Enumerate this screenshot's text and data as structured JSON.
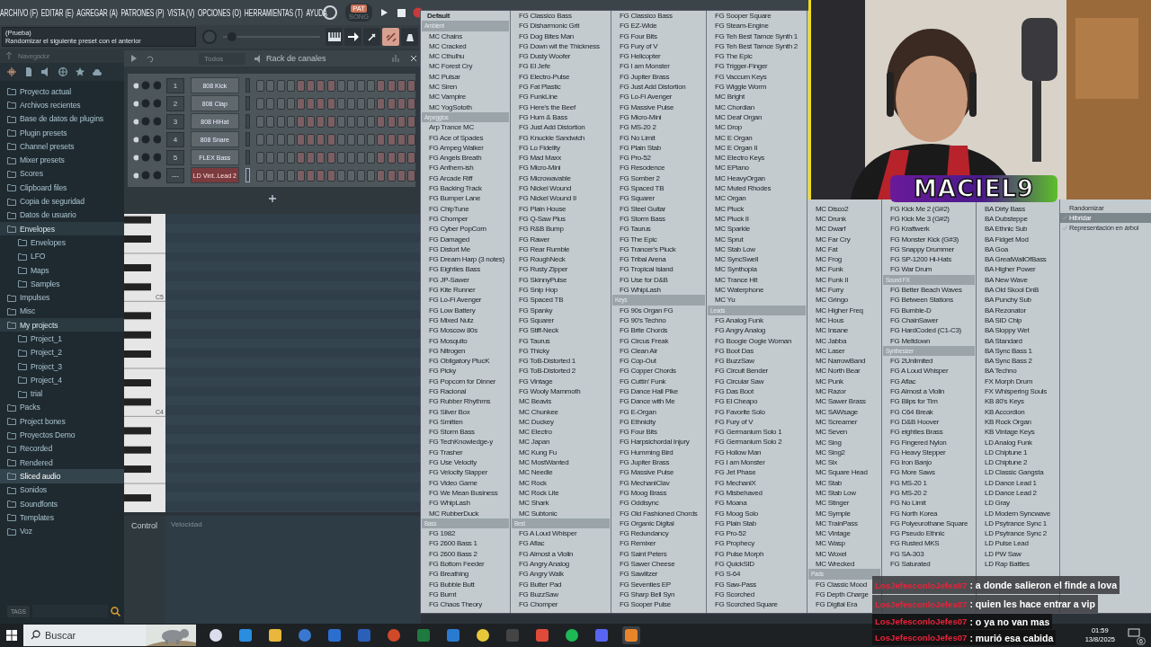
{
  "menu": [
    "ARCHIVO (F)",
    "EDITAR (E)",
    "AGREGAR (A)",
    "PATRONES (P)",
    "VISTA (V)",
    "OPCIONES (O)",
    "HERRAMIENTAS (T)",
    "AYUDA"
  ],
  "transport": {
    "modes": [
      {
        "label": "PAT",
        "selected": true
      },
      {
        "label": "SONG",
        "selected": false
      }
    ]
  },
  "pitch_slider": {
    "level": 0.05
  },
  "hint": {
    "title": "(Prueba)",
    "text": "Randomizar el siguiente preset con el anterior"
  },
  "browser": {
    "title": "Navegador",
    "tags_label": "TAGS",
    "tree": [
      {
        "label": "Proyecto actual",
        "selected": false
      },
      {
        "label": "Archivos recientes",
        "selected": false
      },
      {
        "label": "Base de datos de plugins",
        "selected": false
      },
      {
        "label": "Plugin presets",
        "selected": false
      },
      {
        "label": "Channel presets",
        "selected": false
      },
      {
        "label": "Mixer presets",
        "selected": false
      },
      {
        "label": "Scores",
        "selected": false
      },
      {
        "label": "Clipboard files",
        "selected": false
      },
      {
        "label": "Copia de seguridad",
        "selected": false
      },
      {
        "label": "Datos de usuario",
        "selected": false
      },
      {
        "label": "Envelopes",
        "selected": false,
        "expanded": true,
        "children": [
          {
            "label": "Envelopes",
            "selected": false
          },
          {
            "label": "LFO",
            "selected": false
          },
          {
            "label": "Maps",
            "selected": false
          },
          {
            "label": "Samples",
            "selected": false
          }
        ]
      },
      {
        "label": "Impulses",
        "selected": false
      },
      {
        "label": "Misc",
        "selected": false
      },
      {
        "label": "My projects",
        "selected": false,
        "expanded": true,
        "children": [
          {
            "label": "Project_1",
            "selected": false
          },
          {
            "label": "Project_2",
            "selected": false
          },
          {
            "label": "Project_3",
            "selected": false
          },
          {
            "label": "Project_4",
            "selected": false
          },
          {
            "label": "trial",
            "selected": false
          }
        ]
      },
      {
        "label": "Packs",
        "selected": false
      },
      {
        "label": "Project bones",
        "selected": false
      },
      {
        "label": "Proyectos Demo",
        "selected": false
      },
      {
        "label": "Recorded",
        "selected": false
      },
      {
        "label": "Rendered",
        "selected": false
      },
      {
        "label": "Sliced audio",
        "selected": true
      },
      {
        "label": "Sonidos",
        "selected": false
      },
      {
        "label": "Soundfonts",
        "selected": false
      },
      {
        "label": "Templates",
        "selected": false
      },
      {
        "label": "Voz",
        "selected": false
      }
    ]
  },
  "channel_rack": {
    "filter": "Todos",
    "title": "Rack de canales",
    "channels": [
      {
        "number": "1",
        "name": "808 Kick",
        "selected": false
      },
      {
        "number": "2",
        "name": "808 Clap",
        "selected": false
      },
      {
        "number": "3",
        "name": "808 HiHat",
        "selected": false
      },
      {
        "number": "4",
        "name": "808 Snare",
        "selected": false
      },
      {
        "number": "5",
        "name": "FLEX Bass",
        "selected": false
      },
      {
        "number": "---",
        "name": "LD Vint..Lead 2",
        "selected": true
      }
    ]
  },
  "piano_roll": {
    "key_labels": [
      "C5",
      "C4"
    ],
    "control_label": "Control",
    "control_value": "Velocidad"
  },
  "preset_menu": {
    "default_item": "Default",
    "columns": [
      {
        "groups": [
          {
            "title": "Ambient",
            "items": [
              "MC Chains",
              "MC Cracked",
              "MC Cthulhu",
              "MC Forest Cry",
              "MC Pulsar",
              "MC Siren",
              "MC Vampire",
              "MC YogSototh"
            ]
          },
          {
            "title": "Arpeggios",
            "items": [
              "Arp Trance MC",
              "FG Ace of Spades",
              "FG Ampeg Walker",
              "FG Angels Breath",
              "FG Anthem-ish",
              "FG Arcade Riff",
              "FG Backing Track",
              "FG Bumper Lane",
              "FG ChipTune",
              "FG Chomper",
              "FG Cyber PopCorn",
              "FG Damaged",
              "FG Distort Me",
              "FG Dream Harp (3 notes)",
              "FG Eighties Bass",
              "FG JP-Sawer",
              "FG Kite Runner",
              "FG Lo-Fi Avenger",
              "FG Low Battery",
              "FG Mixed Nutz",
              "FG Moscow 80s",
              "FG Mosquito",
              "FG Nitrogen",
              "FG Obligatory PlucK",
              "FG Picky",
              "FG Popcorn for Dinner",
              "FG Racional",
              "FG Rubber Rhythms",
              "FG Silver Box",
              "FG Smitten",
              "FG Storm Bass",
              "FG TechKnowledge-y",
              "FG Trasher",
              "FG Use Velocity",
              "FG Velocity Slapper",
              "FG Video Game",
              "FG We Mean Business",
              "FG WhipLash",
              "MC RubberDuck"
            ]
          },
          {
            "title": "Bass",
            "items": [
              "FG 1982",
              "FG 2600 Bass 1",
              "FG 2600 Bass 2",
              "FG Bottom Feeder",
              "FG Breathing",
              "FG Bubble Butt",
              "FG Burnt",
              "FG Chaos Theory"
            ]
          }
        ]
      },
      {
        "groups": [
          {
            "items": [
              "FG Classico Bass",
              "FG Disharmonic Grit",
              "FG Dog Bites Man",
              "FG Down wit the Thickness",
              "FG Dusty Woofer",
              "FG El Jefe",
              "FG Electro-Pulse",
              "FG Fat Plastic",
              "FG FunkLine",
              "FG Here's the Beef",
              "FG Hum & Bass",
              "FG Just Add Distortion",
              "FG Knuckle Sandwich",
              "FG Lo Fidelity",
              "FG Mad Maxx",
              "FG Micro-Mini",
              "FG Microwavable",
              "FG Nickel Wound",
              "FG Nickel Wound II",
              "FG Plain House",
              "FG Q-Saw Plus",
              "FG R&B Bump",
              "FG Rawer",
              "FG Rear Rumble",
              "FG RoughNeck",
              "FG Rusty Zipper",
              "FG SkinnyPulse",
              "FG Snip Hop",
              "FG Spaced TB",
              "FG Spanky",
              "FG Squarer",
              "FG Stiff-Neck",
              "FG Taurus",
              "FG Thicky",
              "FG ToB-Distorted 1",
              "FG ToB-Distorted 2",
              "FG Vintage",
              "FG Wooly Mammoth",
              "MC Beavis",
              "MC Chunkee",
              "MC Duckey",
              "MC Electro",
              "MC Japan",
              "MC Kung Fu",
              "MC MostWanted",
              "MC Needle",
              "MC Rock",
              "MC Rock Lite",
              "MC Shark",
              "MC Subtonic"
            ]
          },
          {
            "title": "Best",
            "items": [
              "FG A Loud Whisper",
              "FG Aflac",
              "FG Almost a Violin",
              "FG Angry Analog",
              "FG Angry Walk",
              "FG Butter Pad",
              "FG BuzzSaw",
              "FG Chomper"
            ]
          }
        ]
      },
      {
        "groups": [
          {
            "items": [
              "FG Classico Bass",
              "FG EZ-Wide",
              "FG Four Bits",
              "FG Fury of V",
              "FG Helicopter",
              "FG I am Monster",
              "FG Jupiter Brass",
              "FG Just Add Distortion",
              "FG Lo-Fi Avenger",
              "FG Massive Pulse",
              "FG Micro-Mini",
              "FG MS-20 2",
              "FG No Limit",
              "FG Plain Stab",
              "FG Pro-52",
              "FG Resodence",
              "FG Somber 2",
              "FG Spaced TB",
              "FG Squarer",
              "FG Steel Guitar",
              "FG Storm Bass",
              "FG Taurus",
              "FG The Epic",
              "FG Trancer's Pluck",
              "FG Tribal Arena",
              "FG Tropical Island",
              "FG Use for D&B",
              "FG WhipLash"
            ]
          },
          {
            "title": "Keys",
            "items": [
              "FG 90s Organ FG",
              "FG 90's Techno",
              "FG Brite Chords",
              "FG Circus Freak",
              "FG Clean Air",
              "FG Cop-Out",
              "FG Copper Chords",
              "FG Cuttin' Funk",
              "FG Dance Hall Pike",
              "FG Dance with Me",
              "FG E-Organ",
              "FG Ethnicity",
              "FG Four Bits",
              "FG Harpsichordal Injury",
              "FG Humming Bird",
              "FG Jupiter Brass",
              "FG Massive Pulse",
              "FG MechaniClav",
              "FG Moog Brass",
              "FG Oddisync",
              "FG Old Fashioned Chords",
              "FG Organic Digital",
              "FG Redundancy",
              "FG Remixer",
              "FG Saint Peters",
              "FG Sawer Cheese",
              "FG Sawlitzer",
              "FG Seventies EP",
              "FG Sharp Bell Syn",
              "FG Sooper Pulse"
            ]
          }
        ]
      },
      {
        "groups": [
          {
            "items": [
              "FG Sooper Square",
              "FG Steam-Engine",
              "FG Teh Best Tarnce Synth 1",
              "FG Teh Best Tarnce Synth 2",
              "FG The Epic",
              "FG Trigger-Finger",
              "FG Vaccum Keys",
              "FG Wiggle Worm",
              "MC Bright",
              "MC Chordian",
              "MC Deaf Organ",
              "MC Drop",
              "MC E Organ",
              "MC E Organ II",
              "MC Electro Keys",
              "MC EPiano",
              "MC HeavyOrgan",
              "MC Muted Rhodes",
              "MC Organ",
              "MC Pluck",
              "MC Pluck II",
              "MC Sparkle",
              "MC Sprut",
              "MC Stab Low",
              "MC SyncSwell",
              "MC Synthopia",
              "MC Trance Hit",
              "MC Waterphone",
              "MC Yu"
            ]
          },
          {
            "title": "Leads",
            "items": [
              "FG Analog Funk",
              "FG Angry Analog",
              "FG Boogie Oogie Woman",
              "FG Boot Das",
              "FG BuzzSaw",
              "FG Circuit Bender",
              "FG Circular Saw",
              "FG Das Boot",
              "FG El Cheapo",
              "FG Favorite Solo",
              "FG Fury of V",
              "FG Germanium Solo 1",
              "FG Germanium Solo 2",
              "FG Hollow Man",
              "FG I am Monster",
              "FG Jet Phase",
              "FG MechaniX",
              "FG Misbehaved",
              "FG Moana",
              "FG Moog Solo",
              "FG Plain Stab",
              "FG Pro-52",
              "FG Prophecy",
              "FG Pulse Morph",
              "FG QuickSID",
              "FG S-64",
              "FG Saw-Pass",
              "FG Scorched",
              "FG Scorched Square"
            ]
          }
        ]
      },
      {
        "groups": [
          {
            "items": [
              "MC Disco2",
              "MC Drunk",
              "MC Dwarf",
              "MC Far Cry",
              "MC Fat",
              "MC Frog",
              "MC Funk",
              "MC Funk II",
              "MC Furry",
              "MC Gringo",
              "MC Higher Freq",
              "MC Hous",
              "MC Insane",
              "MC Jabba",
              "MC Laser",
              "MC NarrowBand",
              "MC North Bear",
              "MC Punk",
              "MC Razor",
              "MC Sawer Brass",
              "MC SAWsage",
              "MC Screamer",
              "MC Seven",
              "MC Sing",
              "MC Sing2",
              "MC Six",
              "MC Square Head",
              "MC Stab",
              "MC Stab Low",
              "MC Stinger",
              "MC Symple",
              "MC TrainPass",
              "MC Vintage",
              "MC Wasp",
              "MC Woxel",
              "MC Wrecked"
            ]
          },
          {
            "title": "Pads",
            "items": [
              "FG Classic Mood",
              "FG Depth Charge",
              "FG Digital Era"
            ]
          }
        ]
      },
      {
        "groups": [
          {
            "items": [
              "FG Kick Me 2 (G#2)",
              "FG Kick Me 3 (G#2)",
              "FG Kraftwerk",
              "FG Monster Kick (G#3)",
              "FG Snappy Drummer",
              "FG SP-1200 Hi-Hats",
              "FG War Drum"
            ]
          },
          {
            "title": "Sound FX",
            "items": [
              "FG Better Beach Waves",
              "FG Between Stations",
              "FG Bumble-D",
              "FG ChainSawer",
              "FG HardCoded (C1-C3)",
              "FG Meltdown"
            ]
          },
          {
            "title": "Synthesizer",
            "items": [
              "FG 2Unlimited",
              "FG A Loud Whisper",
              "FG Aflac",
              "FG Almost a Violin",
              "FG Blips for Tim",
              "FG C64 Break",
              "FG D&B Hoover",
              "FG eighties Brass",
              "FG Fingered Nylon",
              "FG Heavy Stepper",
              "FG Iron Banjo",
              "FG More Saws",
              "FG MS-20 1",
              "FG MS-20 2",
              "FG No Limit",
              "FG North Korea",
              "FG Polyeurothane Square",
              "FG Pseudo Ethnic",
              "FG Rusted MKS",
              "FG SA-303",
              "FG Saturated"
            ]
          }
        ]
      },
      {
        "groups": [
          {
            "items": [
              "BA Dirty Bass",
              "BA Dubsteppe",
              "BA Ethnic Sub",
              "BA Fidget Mod",
              "BA Goa",
              "BA GreatWallOfBass",
              "BA Higher Power",
              "BA New Wave",
              "BA Old Skool DnB",
              "BA Punchy Sub",
              "BA Rezonator",
              "BA SID Chip",
              "BA Sloppy Wet",
              "BA Standard",
              "BA Sync Bass 1",
              "BA Sync Bass 2",
              "BA Techno",
              "FX Morph Drum",
              "FX Whispering Souls",
              "KB 80's Keys",
              "KB Accordion",
              "KB Rock Organ",
              "KB Vintage Keys",
              "LD Analog Funk",
              "LD Chiptune 1",
              "LD Chiptune 2",
              "LD Classic Gangsta",
              "LD Dance Lead 1",
              "LD Dance Lead 2",
              "LD Gray",
              "LD Modern Syncwave",
              "LD Psytrance Sync 1",
              "LD Psytrance Sync 2",
              "LD Pulse Lead",
              "LD PW Saw",
              "LD Rap Battles"
            ]
          }
        ]
      }
    ],
    "options": [
      {
        "label": "Randomizar",
        "checked": false,
        "selected": false
      },
      {
        "label": "Hibridar",
        "checked": true,
        "selected": true
      },
      {
        "label": "Representación en árbol",
        "checked": true,
        "selected": false
      }
    ]
  },
  "stream_overlay": {
    "streamer_name": "MACIEL9"
  },
  "chat": [
    {
      "user": "LosJefesconloJefes07",
      "message": ": a donde salieron el finde a lova"
    },
    {
      "user": "LosJefesconloJefes07",
      "message": ": quien les hace entrar a vip"
    },
    {
      "user": "LosJefesconloJefes07",
      "message": ": o ya no van mas"
    },
    {
      "user": "LosJefesconloJefes07",
      "message": ": murió esa cabida"
    }
  ],
  "taskbar": {
    "search": {
      "placeholder": "Buscar"
    },
    "time": "01:59",
    "date": "13/8/2025",
    "notification_count": "6"
  }
}
